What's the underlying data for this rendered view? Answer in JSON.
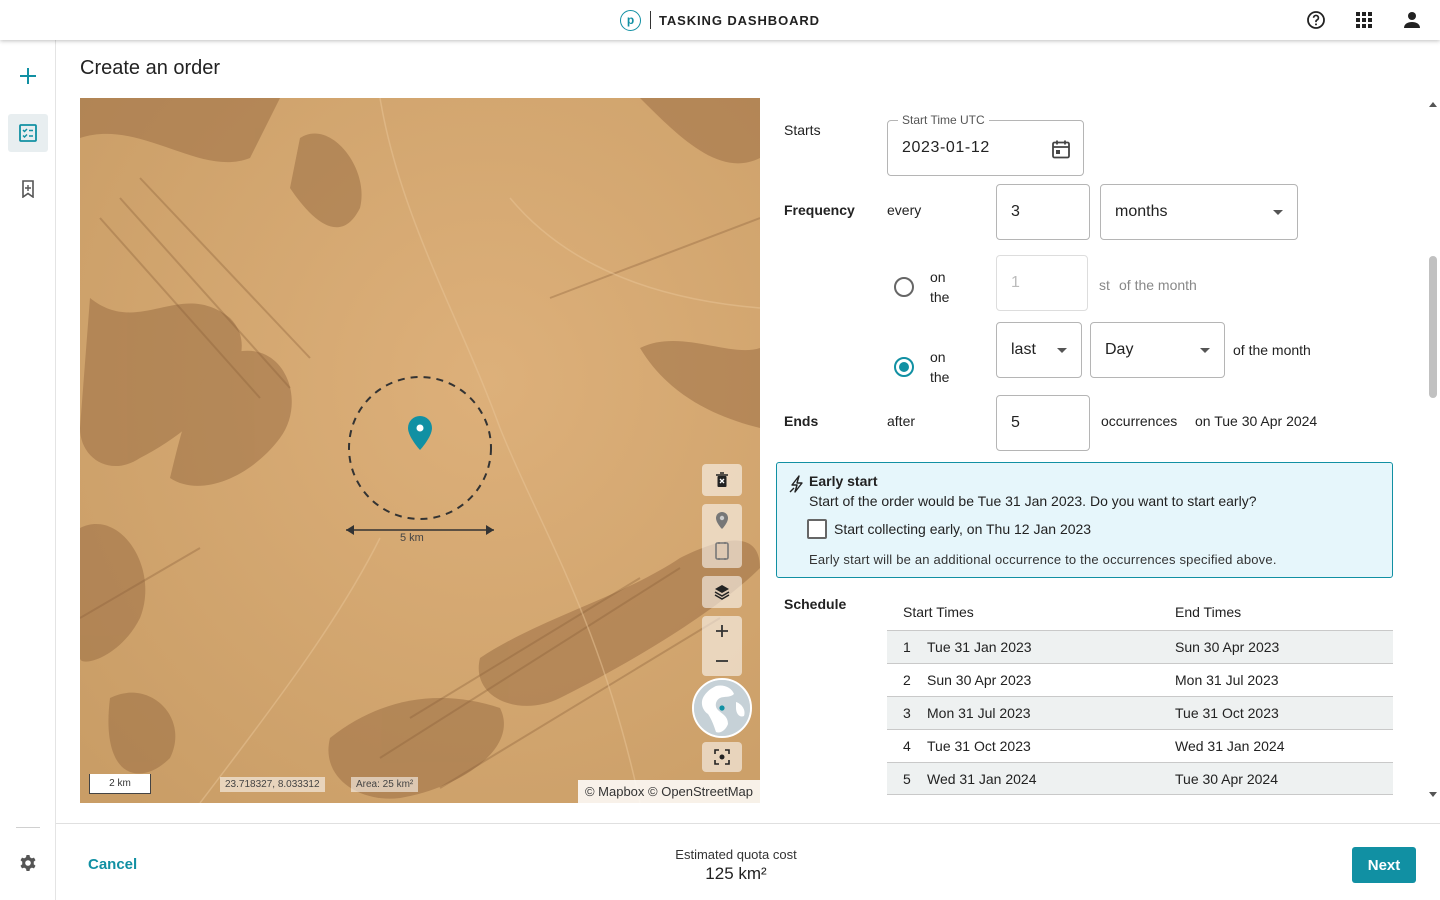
{
  "header": {
    "title": "TASKING DASHBOARD",
    "logo_letter": "p",
    "icons": [
      "help-icon",
      "apps-grid-icon",
      "account-icon"
    ]
  },
  "rail": {
    "icons": [
      "add-icon",
      "order-list-icon",
      "bookmark-icon",
      "settings-icon"
    ]
  },
  "page": {
    "title": "Create an order"
  },
  "map": {
    "distance_label": "5 km",
    "scale_label": "2 km",
    "coordinates": "23.718327, 8.033312",
    "area": "Area: 25 km²",
    "attribution": "© Mapbox © OpenStreetMap",
    "controls": [
      "delete-icon",
      "pin-icon",
      "rectangle-icon",
      "layers-icon",
      "zoom-in-icon",
      "zoom-out-icon",
      "globe-icon",
      "recenter-icon"
    ]
  },
  "form": {
    "starts_label": "Starts",
    "start_time_legend": "Start Time UTC",
    "start_time_value": "2023-01-12",
    "frequency_label": "Frequency",
    "every_label": "every",
    "every_value": "3",
    "unit_value": "months",
    "option1": {
      "on": "on",
      "the": "the",
      "day_placeholder": "1",
      "suffix_st": "st",
      "suffix": "of the month",
      "selected": false
    },
    "option2": {
      "on": "on",
      "the": "the",
      "position_value": "last",
      "weekday_value": "Day",
      "suffix": "of the month",
      "selected": true
    },
    "ends_label": "Ends",
    "after_label": "after",
    "after_value": "5",
    "occurrences_label": "occurrences",
    "ends_on": "on Tue 30 Apr 2024"
  },
  "early_start": {
    "title": "Early start",
    "message": "Start of the order would be Tue 31 Jan 2023. Do you want to start early?",
    "checkbox_label": "Start collecting early, on Thu 12 Jan 2023",
    "checked": false,
    "note": "Early start will be an additional occurrence to the occurrences specified above."
  },
  "schedule": {
    "label": "Schedule",
    "columns": [
      "Start Times",
      "End Times"
    ],
    "rows": [
      {
        "n": "1",
        "start": "Tue 31 Jan 2023",
        "end": "Sun 30 Apr 2023"
      },
      {
        "n": "2",
        "start": "Sun 30 Apr 2023",
        "end": "Mon 31 Jul 2023"
      },
      {
        "n": "3",
        "start": "Mon 31 Jul 2023",
        "end": "Tue 31 Oct 2023"
      },
      {
        "n": "4",
        "start": "Tue 31 Oct 2023",
        "end": "Wed 31 Jan 2024"
      },
      {
        "n": "5",
        "start": "Wed 31 Jan 2024",
        "end": "Tue 30 Apr 2024"
      }
    ]
  },
  "footer": {
    "cancel_label": "Cancel",
    "quota_label": "Estimated quota cost",
    "quota_value": "125 km²",
    "next_label": "Next"
  },
  "colors": {
    "accent": "#1190a3",
    "alert_bg": "#e6f6fb",
    "map_sand": "#d4a66e"
  }
}
